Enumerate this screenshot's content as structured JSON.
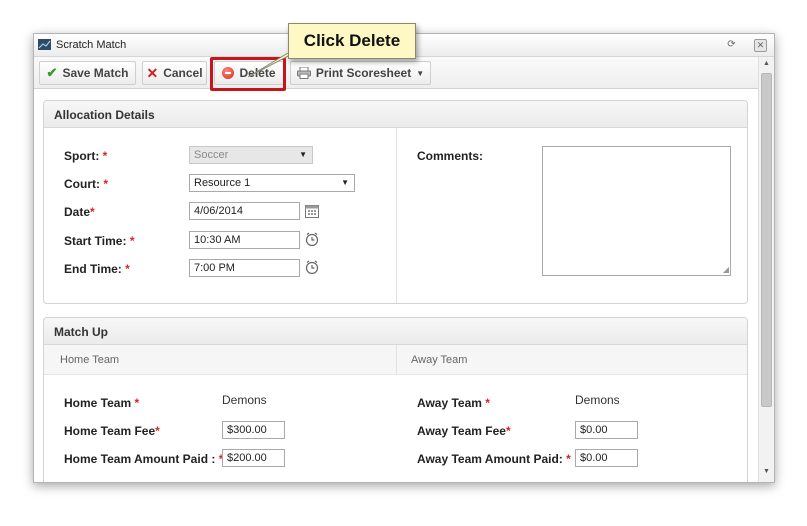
{
  "window": {
    "title": "Scratch Match"
  },
  "toolbar": {
    "save_label": "Save Match",
    "cancel_label": "Cancel",
    "delete_label": "Delete",
    "print_label": "Print Scoresheet"
  },
  "callout": {
    "text": "Click Delete"
  },
  "allocation": {
    "title": "Allocation Details",
    "sport_label": "Sport:",
    "sport_value": "Soccer",
    "court_label": "Court:",
    "court_value": "Resource 1",
    "date_label": "Date",
    "date_value": "4/06/2014",
    "start_label": "Start Time:",
    "start_value": "10:30 AM",
    "end_label": "End Time:",
    "end_value": "7:00 PM",
    "comments_label": "Comments:",
    "required_mark": "*"
  },
  "match_up": {
    "title": "Match Up",
    "home_header": "Home Team",
    "away_header": "Away Team",
    "home_team_label": "Home Team",
    "home_team_value": "Demons",
    "home_fee_label": "Home Team Fee",
    "home_fee_value": "$300.00",
    "home_paid_label": "Home Team Amount Paid :",
    "home_paid_value": "$200.00",
    "away_team_label": "Away Team",
    "away_team_value": "Demons",
    "away_fee_label": "Away Team Fee",
    "away_fee_value": "$0.00",
    "away_paid_label": "Away Team Amount Paid:",
    "away_paid_value": "$0.00"
  },
  "colors": {
    "highlight": "#c6141c",
    "callout_bg": "#fdf8c4",
    "required": "#dd2222"
  }
}
